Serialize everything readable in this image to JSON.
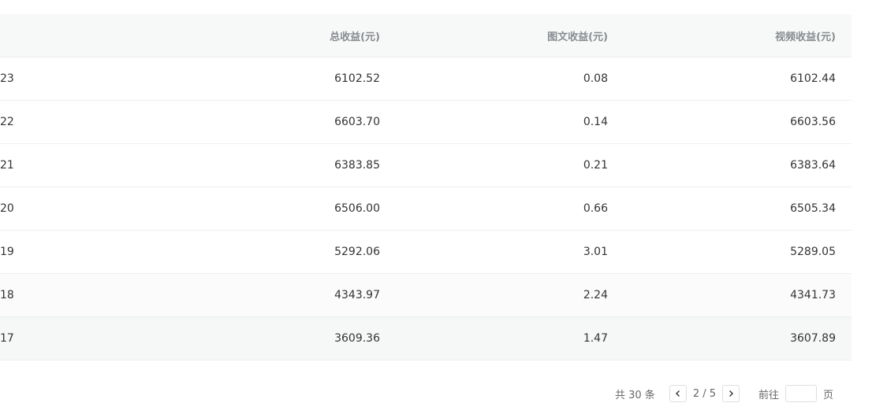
{
  "table": {
    "headers": {
      "total": "总收益(元)",
      "graphic": "图文收益(元)",
      "video": "视频收益(元)"
    },
    "rows": [
      {
        "date": "23",
        "total": "6102.52",
        "graphic": "0.08",
        "video": "6102.44"
      },
      {
        "date": "22",
        "total": "6603.70",
        "graphic": "0.14",
        "video": "6603.56"
      },
      {
        "date": "21",
        "total": "6383.85",
        "graphic": "0.21",
        "video": "6383.64"
      },
      {
        "date": "20",
        "total": "6506.00",
        "graphic": "0.66",
        "video": "6505.34"
      },
      {
        "date": "19",
        "total": "5292.06",
        "graphic": "3.01",
        "video": "5289.05"
      },
      {
        "date": "18",
        "total": "4343.97",
        "graphic": "2.24",
        "video": "4341.73"
      },
      {
        "date": "17",
        "total": "3609.36",
        "graphic": "1.47",
        "video": "3607.89"
      }
    ]
  },
  "pagination": {
    "total_text": "共 30 条",
    "page_info": "2 / 5",
    "goto_label": "前往",
    "goto_suffix": "页",
    "goto_value": ""
  }
}
